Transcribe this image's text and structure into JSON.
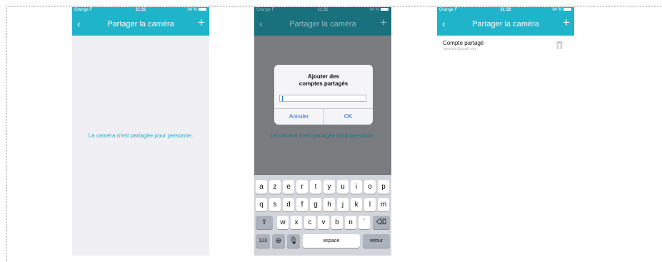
{
  "colors": {
    "accent": "#1fb4c9",
    "link_blue": "#1f6fd6"
  },
  "screens": [
    {
      "status": {
        "carrier": "Orange F",
        "time": "11:31",
        "battery": "94 %"
      },
      "nav": {
        "title": "Partager la caméra",
        "back_icon": "chevron-left-icon",
        "add_icon": "plus-icon"
      },
      "empty_message": "La caméra n'est partagée pour personne."
    },
    {
      "status": {
        "carrier": "Orange F",
        "time": "11:31",
        "battery": "94 %"
      },
      "nav": {
        "title": "Partager la caméra"
      },
      "empty_message": "La caméra n'est partagée pour personne.",
      "dialog": {
        "title_line1": "Ajouter des",
        "title_line2": "comptes partagés",
        "input_value": "",
        "cancel_label": "Annuler",
        "ok_label": "OK"
      },
      "keyboard": {
        "row1": [
          "a",
          "z",
          "e",
          "r",
          "t",
          "y",
          "u",
          "i",
          "o",
          "p"
        ],
        "row2": [
          "q",
          "s",
          "d",
          "f",
          "g",
          "h",
          "j",
          "k",
          "l",
          "m"
        ],
        "row3": [
          "w",
          "x",
          "c",
          "v",
          "b",
          "n",
          "´"
        ],
        "numbers_label": "123",
        "space_label": "espace",
        "return_label": "retour"
      }
    },
    {
      "status": {
        "carrier": "Orange F",
        "time": "11:32",
        "battery": "94 %"
      },
      "nav": {
        "title": "Partager la caméra"
      },
      "shared_account": {
        "title": "Compte partagé",
        "email": "ogrunien@gmail.com",
        "delete_icon": "trash-icon"
      }
    }
  ]
}
